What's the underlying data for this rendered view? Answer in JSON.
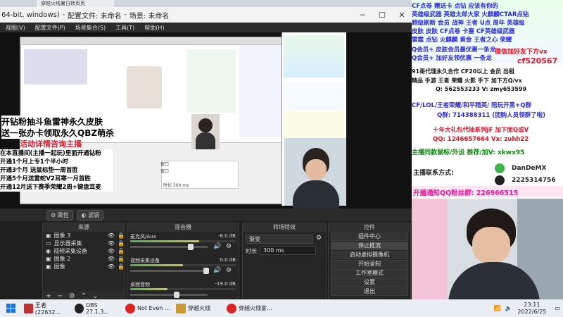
{
  "window": {
    "title_prefix": "64-bit, windows)",
    "profile": "配置文件: 未命名",
    "scene_collection": "场景: 未命名"
  },
  "browser_tab": {
    "title": "穿越火线暑日转页页"
  },
  "menu": [
    "视图(V)",
    "配置文件(P)",
    "场景集合(S)",
    "工具(T)",
    "帮助(H)"
  ],
  "preview": {
    "overlay_lines": [
      "开钻粉抽斗鱼雷神永久皮肤",
      "送一张办卡领取永久QBZ萌杀"
    ],
    "overlay_red": "活动详情咨询主播",
    "promo_lines": [
      "在本直播间(主播一起玩)里面开通钻粉",
      "开通1个月上专1个半小时",
      "开通3个月 送鼠标垫一周首胜",
      "开通5个月送雷蛇V2耳寒一月首胜",
      "开通12月送下赛季荣耀2周+键盘耳麦"
    ],
    "small_fields": [
      "窗口",
      "窗口",
      "时长  300 ms"
    ]
  },
  "toolbar_row": {
    "properties": "属性",
    "filters": "滤镜"
  },
  "sources": {
    "header": "来源",
    "items": [
      "图像 3",
      "显示器采集",
      "视频采集设备",
      "图像 2",
      "图像"
    ]
  },
  "mixer": {
    "header": "混音器",
    "channels": [
      {
        "name": "麦克风/Aux",
        "db": "-8.0 dB",
        "level": 0.65
      },
      {
        "name": "视频采集设备",
        "db": "0.0 dB",
        "level": 0.5
      },
      {
        "name": "桌面音频",
        "db": "-19.0 dB",
        "level": 0.35
      }
    ]
  },
  "transitions": {
    "header": "转场特效",
    "type": "渐变",
    "duration_label": "时长",
    "duration_value": "300 ms"
  },
  "controls": {
    "header": "控件",
    "buttons": [
      "插件中心",
      "停止推流",
      "启动虚拟摄像机",
      "开始录制",
      "工作室模式",
      "设置",
      "退出"
    ]
  },
  "right_panel": {
    "lines": [
      {
        "text": "CF点卷 赠送卡 点钻 应该有你的",
        "color": "#2b2bd9"
      },
      {
        "text": "英雄级武器 英雄太郎大家 火麒麟CTAR点钻",
        "color": "#2b2bd9"
      },
      {
        "text": "超级刷新 会员 战神 王者 U点 周年 英雄级",
        "color": "#2b2bd9"
      },
      {
        "text": "皮肤 皮肤 CF点卷 卡塞 CF英雄级武器",
        "color": "#2b2bd9"
      },
      {
        "text": "雷霆 点钻 火麒麟 黄金 王者之心 荣耀",
        "color": "#2b2bd9"
      },
      {
        "text": "Q会员+ 皮肤会员最优惠一条龙",
        "color": "#2b2bd9"
      },
      {
        "text": "Q会员+ 加好友领优惠 一条龙",
        "color": "#2b2bd9"
      }
    ],
    "red_tag": "微信加好友下方vx",
    "red_code": "cf520567",
    "section2": [
      "91哥代理永久合作 CF20以上     会员 出租",
      "精品 手游 王者 荣耀 火影 手下 加下方Q/vx",
      "Q: 562553233 V: zmy653599"
    ],
    "section3": [
      "CF/LOL/王者荣耀/和平精英/ 陪玩开黑+Q群",
      "Q群: 714388311 (团购人员领群了啦)"
    ],
    "section4_red": "十年大礼包代抽系列JF 加下面Q或V",
    "section4_ids": "QQ:  1246657664  Vx:  zuhh22",
    "section5_green": "主播同款鼠标/外设 推荐/加V:  xkwx95",
    "contact_label": "主播联系方式:",
    "wechat_id": "DanDeMX",
    "qq_id": "2225314756",
    "fan_group": "开播通知QQ粉丝群:  226966515"
  },
  "taskbar": {
    "items": [
      {
        "label": "王者(22632...",
        "color": "#b33"
      },
      {
        "label": "OBS 27.1.3...",
        "color": "#222"
      },
      {
        "label": "Not Even ...",
        "color": "#d22"
      },
      {
        "label": "穿越火线",
        "color": "#c93"
      },
      {
        "label": "穿越火线宴...",
        "color": "#d22"
      }
    ],
    "time": "23:11",
    "date": "2022/6/25"
  }
}
